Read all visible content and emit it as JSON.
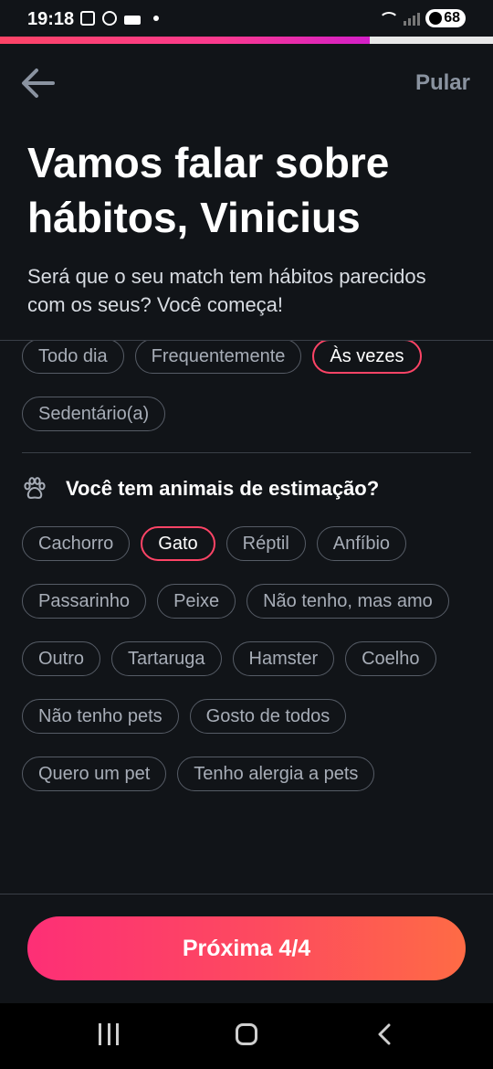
{
  "status_bar": {
    "time": "19:18",
    "battery": "68"
  },
  "progress": {
    "value_percent": 75,
    "fill_color": "#fd4466"
  },
  "header": {
    "back_icon": "arrow-left-icon",
    "skip_label": "Pular"
  },
  "page": {
    "title": "Vamos falar sobre hábitos, Vinicius",
    "subtitle": "Será que o seu match tem hábitos parecidos com os seus? Você começa!"
  },
  "previous_section": {
    "options": [
      {
        "label": "Todo dia",
        "selected": false
      },
      {
        "label": "Frequentemente",
        "selected": false
      },
      {
        "label": "Às vezes",
        "selected": true
      },
      {
        "label": "Sedentário(a)",
        "selected": false
      }
    ]
  },
  "pets_section": {
    "icon": "paw-icon",
    "question": "Você tem animais de estimação?",
    "options": [
      {
        "label": "Cachorro",
        "selected": false
      },
      {
        "label": "Gato",
        "selected": true
      },
      {
        "label": "Réptil",
        "selected": false
      },
      {
        "label": "Anfíbio",
        "selected": false
      },
      {
        "label": "Passarinho",
        "selected": false
      },
      {
        "label": "Peixe",
        "selected": false
      },
      {
        "label": "Não tenho, mas amo",
        "selected": false
      },
      {
        "label": "Outro",
        "selected": false
      },
      {
        "label": "Tartaruga",
        "selected": false
      },
      {
        "label": "Hamster",
        "selected": false
      },
      {
        "label": "Coelho",
        "selected": false
      },
      {
        "label": "Não tenho pets",
        "selected": false
      },
      {
        "label": "Gosto de todos",
        "selected": false
      },
      {
        "label": "Quero um pet",
        "selected": false
      },
      {
        "label": "Tenho alergia a pets",
        "selected": false
      }
    ]
  },
  "footer": {
    "next_label": "Próxima 4/4"
  },
  "colors": {
    "background": "#111418",
    "accent": "#fd4466",
    "chip_border": "#565c66",
    "chip_text": "#a7adb7"
  }
}
